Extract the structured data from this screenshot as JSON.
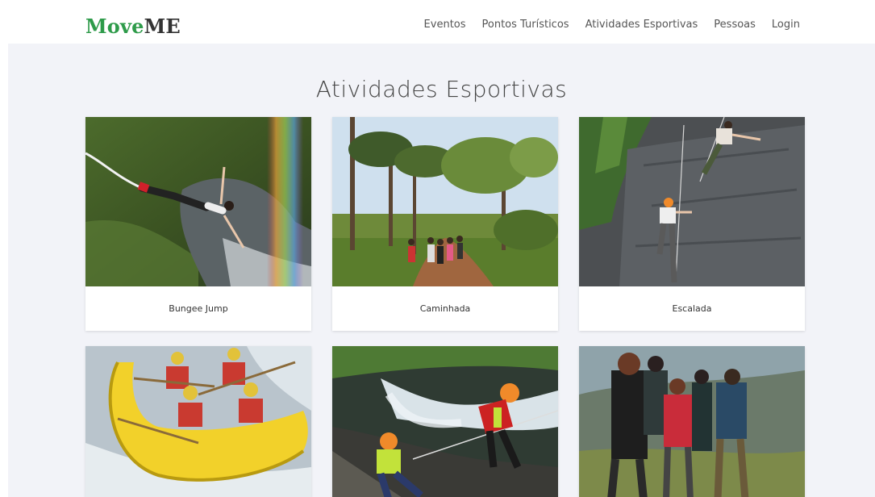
{
  "brand": {
    "part1": "Move",
    "part2": "ME"
  },
  "nav": [
    "Eventos",
    "Pontos Turísticos",
    "Atividades Esportivas",
    "Pessoas",
    "Login"
  ],
  "page_title": "Atividades Esportivas",
  "cards": [
    {
      "label": "Bungee Jump",
      "image": "bungee-jump-photo"
    },
    {
      "label": "Caminhada",
      "image": "hiking-trail-photo"
    },
    {
      "label": "Escalada",
      "image": "rock-climbing-photo"
    },
    {
      "label": "",
      "image": "rafting-photo"
    },
    {
      "label": "",
      "image": "canyoning-photo"
    },
    {
      "label": "",
      "image": "trekking-group-photo"
    }
  ]
}
